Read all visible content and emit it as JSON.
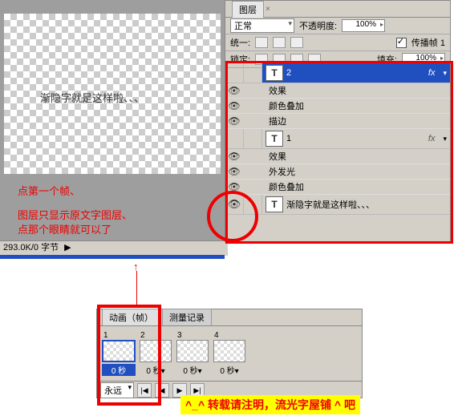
{
  "canvas": {
    "text": "渐隐字就是这样啦、、、"
  },
  "notes": {
    "line1": "点第一个帧、",
    "line2a": "图层只显示原文字图层、",
    "line2b": "点那个眼睛就可以了"
  },
  "status": "293.0K/0 字节",
  "layers_panel": {
    "tab": "图层",
    "blend_mode": "正常",
    "opacity_label": "不透明度:",
    "opacity_value": "100%",
    "unify_label": "统一:",
    "propagate_label": "传播帧 1",
    "lock_label": "锁定:",
    "fill_label": "填充:",
    "fill_value": "100%",
    "layers": [
      {
        "name": "2",
        "type": "T",
        "selected": true,
        "fx": "fx"
      },
      {
        "name": "1",
        "type": "T",
        "selected": false,
        "fx": "fx"
      }
    ],
    "effects": {
      "fx_label": "效果",
      "color_overlay": "颜色叠加",
      "stroke": "描边",
      "outer_glow": "外发光"
    },
    "bg_layer": "渐隐字就是这样啦、、、"
  },
  "animation": {
    "tab1": "动画（帧）",
    "tab2": "测量记录",
    "frames": [
      {
        "num": "1",
        "time": "0 秒",
        "sel": true
      },
      {
        "num": "2",
        "time": "0 秒▾",
        "sel": false
      },
      {
        "num": "3",
        "time": "0 秒▾",
        "sel": false
      },
      {
        "num": "4",
        "time": "0 秒▾",
        "sel": false
      }
    ],
    "loop": "永远"
  },
  "watermark": "^_^ 转载请注明，流光字屋铺 ^ 吧"
}
